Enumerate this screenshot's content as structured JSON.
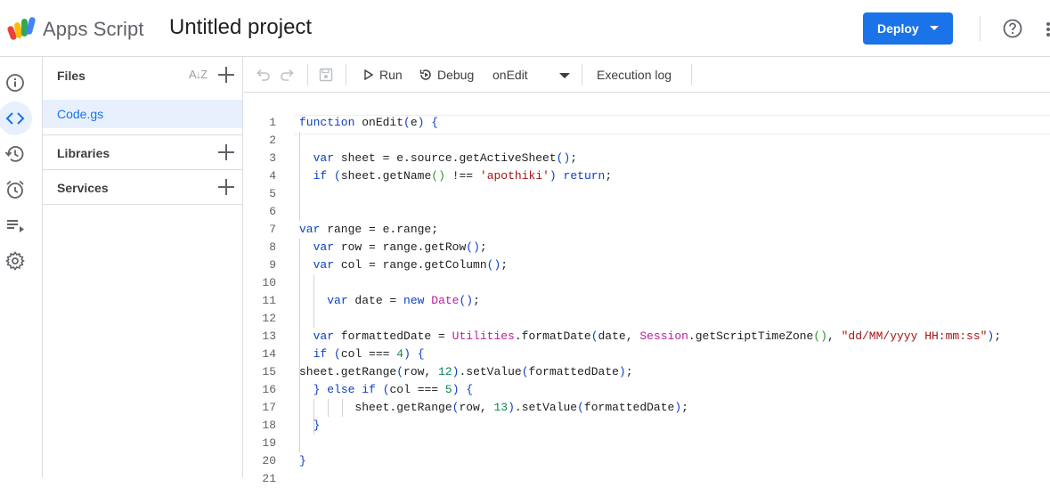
{
  "header": {
    "app_name": "Apps Script",
    "project_title": "Untitled project",
    "deploy_label": "Deploy"
  },
  "files_panel": {
    "files_heading": "Files",
    "active_file": "Code.gs",
    "libraries_heading": "Libraries",
    "services_heading": "Services"
  },
  "toolbar": {
    "run_label": "Run",
    "debug_label": "Debug",
    "function_select": "onEdit",
    "execution_log_label": "Execution log"
  },
  "editor": {
    "line_numbers": [
      "1",
      "2",
      "3",
      "4",
      "5",
      "6",
      "7",
      "8",
      "9",
      "10",
      "11",
      "12",
      "13",
      "14",
      "15",
      "16",
      "17",
      "18",
      "19",
      "20",
      "21"
    ],
    "lines": [
      "function onEdit(e) {",
      "",
      "  var sheet = e.source.getActiveSheet();",
      "  if (sheet.getName() !== 'apothiki') return;",
      "",
      "",
      "var range = e.range;",
      "  var row = range.getRow();",
      "  var col = range.getColumn();",
      "",
      "    var date = new Date();",
      "",
      "  var formattedDate = Utilities.formatDate(date, Session.getScriptTimeZone(), \"dd/MM/yyyy HH:mm:ss\");",
      "  if (col === 4) {",
      "sheet.getRange(row, 12).setValue(formattedDate);",
      "  } else if (col === 5) {",
      "        sheet.getRange(row, 13).setValue(formattedDate);",
      "  }",
      "",
      "}",
      ""
    ]
  },
  "icons": {
    "rail": [
      "info-icon",
      "code-icon",
      "history-icon",
      "alarm-icon",
      "executions-icon",
      "settings-icon"
    ],
    "toolbar": [
      "undo-icon",
      "redo-icon",
      "save-icon",
      "play-icon",
      "debug-icon",
      "dropdown-icon"
    ]
  },
  "colors": {
    "accent": "#1a73e8",
    "active_bg": "#e8f0fe",
    "keyword": "#0b3fc6",
    "string": "#a31515",
    "number": "#098658",
    "class": "#b5209c"
  }
}
